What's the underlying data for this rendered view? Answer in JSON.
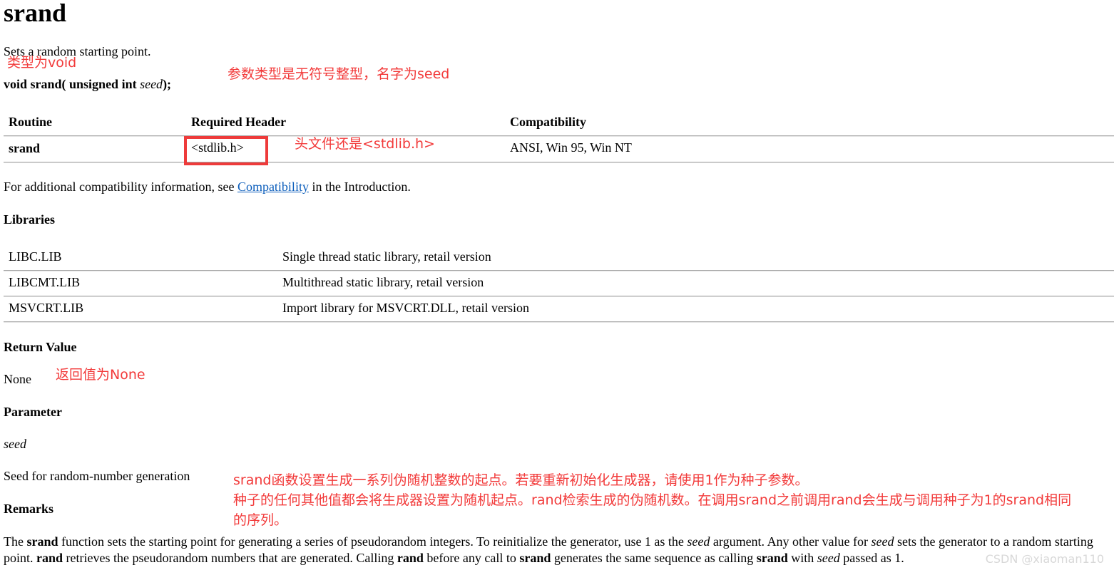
{
  "title": "srand",
  "summary": "Sets a random starting point.",
  "signature": {
    "return_type": "void",
    "func_name": "srand(",
    "param_type": "unsigned int",
    "param_name": "seed",
    "close": ");"
  },
  "req_table": {
    "headers": [
      "Routine",
      "Required Header",
      "Compatibility"
    ],
    "row": [
      "srand",
      "<stdlib.h>",
      "ANSI, Win 95, Win NT"
    ]
  },
  "compat_info": {
    "before": "For additional compatibility information, see",
    "link": "Compatibility",
    "after": "in the Introduction."
  },
  "libraries": {
    "heading": "Libraries",
    "rows": [
      [
        "LIBC.LIB",
        "Single thread static library, retail version"
      ],
      [
        "LIBCMT.LIB",
        "Multithread static library, retail version"
      ],
      [
        "MSVCRT.LIB",
        "Import library for MSVCRT.DLL, retail version"
      ]
    ]
  },
  "return_value": {
    "heading": "Return Value",
    "text": "None"
  },
  "parameter": {
    "heading": "Parameter",
    "name": "seed",
    "desc": "Seed for random-number generation"
  },
  "remarks": {
    "heading": "Remarks",
    "p": {
      "t1": "The",
      "b1": "srand",
      "t2": "function sets the starting point for generating a series of pseudorandom integers. To reinitialize the generator, use 1 as the",
      "i1": "seed",
      "t3": "argument. Any other value for",
      "i2": "seed",
      "t4": "sets the generator to a random starting point.",
      "b2": "rand",
      "t5": "retrieves the pseudorandom numbers that are generated. Calling",
      "b3": "rand",
      "t6": "before any call to",
      "b4": "srand",
      "t7": "generates the same sequence as calling",
      "b5": "srand",
      "t8": "with",
      "i3": "seed",
      "t9": "passed as 1."
    }
  },
  "annotations": {
    "type_void": "类型为void",
    "param_info": "参数类型是无符号整型，名字为seed",
    "header_info": "头文件还是<stdlib.h>",
    "return_none": "返回值为None",
    "desc_line1": "srand函数设置生成一系列伪随机整数的起点。若要重新初始化生成器，请使用1作为种子参数。",
    "desc_line2": "种子的任何其他值都会将生成器设置为随机起点。rand检索生成的伪随机数。在调用srand之前调用rand会生成与调用种子为1的srand相同",
    "desc_line3": "的序列。"
  },
  "watermark": "CSDN @xiaoman110",
  "colors": {
    "annotation": "#f23a3a",
    "link": "#0b5dbb",
    "box": "#ee3b3b"
  }
}
